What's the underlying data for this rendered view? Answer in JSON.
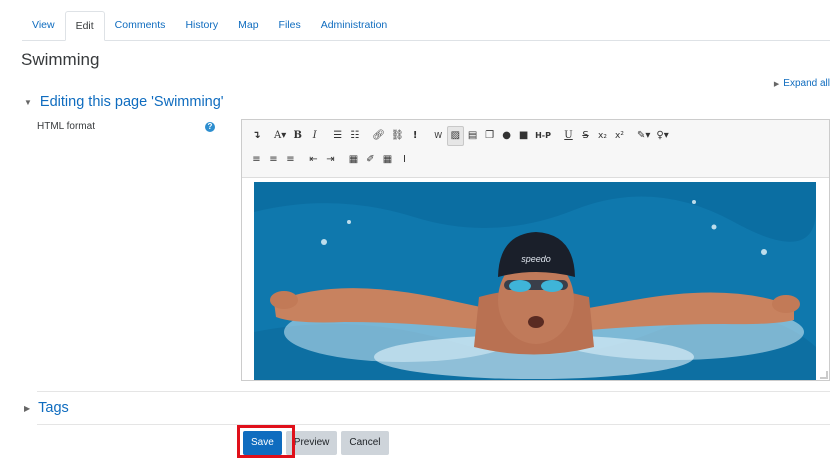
{
  "tabs": [
    "View",
    "Edit",
    "Comments",
    "History",
    "Map",
    "Files",
    "Administration"
  ],
  "active_tab": "Edit",
  "page_title": "Swimming",
  "expand_all": "Expand all",
  "section": {
    "title": "Editing this page 'Swimming'",
    "field_label": "HTML format"
  },
  "toolbar": {
    "row1": [
      "collapse-icon",
      "font-color-icon",
      "bold-icon",
      "italic-icon",
      "unordered-list-icon",
      "ordered-list-icon",
      "link-icon",
      "unlink-icon",
      "emoji-icon",
      "word-import-icon",
      "image-icon",
      "media-icon",
      "manage-files-icon",
      "record-audio-icon",
      "record-video-icon",
      "h5p-icon",
      "underline-icon",
      "strikethrough-icon",
      "subscript-icon",
      "superscript-icon",
      "brush-icon",
      "lightbulb-icon"
    ],
    "row2": [
      "align-left-icon",
      "align-center-icon",
      "align-right-icon",
      "outdent-icon",
      "indent-icon",
      "equation-icon",
      "edit-icon",
      "table-icon",
      "clear-formatting-icon"
    ]
  },
  "editor_image": {
    "alt": "swimmer",
    "cap_text": "speedo"
  },
  "tags_title": "Tags",
  "buttons": {
    "save": "Save",
    "preview": "Preview",
    "cancel": "Cancel"
  },
  "colors": {
    "link": "#0f6cbf",
    "primary_button": "#0f6cbf",
    "highlight": "#e0101a",
    "water": "#1485bb"
  }
}
